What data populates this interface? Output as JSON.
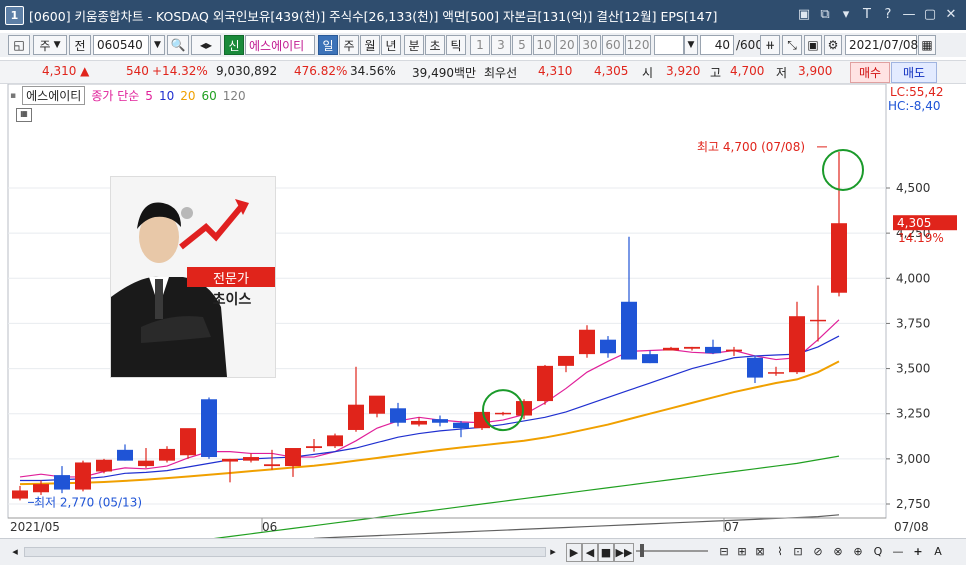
{
  "title": {
    "num": "1",
    "text": "[0600] 키움종합차트 - KOSDAQ 외국인보유[439(천)] 주식수[26,133(천)] 액면[500] 자본금[131(억)] 결산[12월] EPS[147]",
    "icons": [
      "▣",
      "⧉",
      "▾",
      "T",
      "?",
      "—",
      "▢",
      "✕"
    ]
  },
  "toolbar": {
    "type_label": "주",
    "prev_label": "전",
    "code": "060540",
    "badge_new": "신",
    "stock_name": "에스에이티",
    "periods": [
      "일",
      "주",
      "월",
      "년",
      "분",
      "초",
      "틱"
    ],
    "selected_period": "일",
    "intervals": [
      "1",
      "3",
      "5",
      "10",
      "20",
      "30",
      "60",
      "120"
    ],
    "count": "40",
    "count_total": "/600",
    "date": "2021/07/08"
  },
  "quote": {
    "price": "4,310 ▲",
    "change": "540",
    "change_pct": "+14.32%",
    "volume": "9,030,892",
    "vol_ratio": "476.82%",
    "turnover": "34.56%",
    "amount": "39,490백만",
    "best_label": "최우선",
    "ask": "4,310",
    "bid": "4,305",
    "open_label": "시",
    "open": "3,920",
    "high_label": "고",
    "high": "4,700",
    "low_label": "저",
    "low": "3,900",
    "buy_label": "매수",
    "sell_label": "매도"
  },
  "legend": {
    "stock": "에스에이티",
    "ma_label": "종가 단순",
    "ma": [
      "5",
      "10",
      "20",
      "60",
      "120"
    ],
    "ma_colors": [
      "#e0209a",
      "#2030d0",
      "#f0a000",
      "#20a020",
      "#606060"
    ]
  },
  "promo": {
    "badge": "전문가",
    "name": "초이스"
  },
  "annotations": {
    "high": "최고 4,700 (07/08)",
    "low": "최저 2,770 (05/13)",
    "lc": "LC:55,42",
    "hc": "HC:-8,40",
    "last_price": "4,305",
    "last_pct": "14.19%"
  },
  "colors": {
    "up": "#e0241b",
    "down": "#1f54d6"
  },
  "chart_data": {
    "type": "candlestick",
    "ylim": [
      2600,
      4780
    ],
    "yticks": [
      2750,
      3000,
      3250,
      3500,
      3750,
      4000,
      4250,
      4500
    ],
    "ytick_labels": [
      "2,750",
      "3,000",
      "3,250",
      "3,500",
      "3,750",
      "4,000",
      "4,250",
      "4,500"
    ],
    "x_labels": [
      {
        "index": 0,
        "text": "2021/05"
      },
      {
        "index": 12,
        "text": "06"
      },
      {
        "index": 34,
        "text": "07"
      },
      {
        "index": 39,
        "text": "07/08"
      }
    ],
    "candles": [
      {
        "o": 2780,
        "h": 2850,
        "l": 2770,
        "c": 2825
      },
      {
        "o": 2815,
        "h": 2880,
        "l": 2800,
        "c": 2860
      },
      {
        "o": 2910,
        "h": 2960,
        "l": 2810,
        "c": 2830
      },
      {
        "o": 2830,
        "h": 2990,
        "l": 2820,
        "c": 2980
      },
      {
        "o": 2930,
        "h": 3000,
        "l": 2920,
        "c": 2995
      },
      {
        "o": 3050,
        "h": 3080,
        "l": 2990,
        "c": 2990
      },
      {
        "o": 2960,
        "h": 3060,
        "l": 2950,
        "c": 2990
      },
      {
        "o": 2990,
        "h": 3070,
        "l": 2980,
        "c": 3055
      },
      {
        "o": 3020,
        "h": 3150,
        "l": 3000,
        "c": 3170
      },
      {
        "o": 3330,
        "h": 3340,
        "l": 3000,
        "c": 3010
      },
      {
        "o": 2985,
        "h": 3000,
        "l": 2870,
        "c": 3000
      },
      {
        "o": 2990,
        "h": 3030,
        "l": 2980,
        "c": 3010
      },
      {
        "o": 2960,
        "h": 3050,
        "l": 2940,
        "c": 2970
      },
      {
        "o": 2960,
        "h": 3000,
        "l": 2900,
        "c": 3060
      },
      {
        "o": 3060,
        "h": 3110,
        "l": 3040,
        "c": 3070
      },
      {
        "o": 3070,
        "h": 3140,
        "l": 3060,
        "c": 3130
      },
      {
        "o": 3160,
        "h": 3510,
        "l": 3150,
        "c": 3300
      },
      {
        "o": 3250,
        "h": 3340,
        "l": 3230,
        "c": 3350
      },
      {
        "o": 3280,
        "h": 3310,
        "l": 3180,
        "c": 3200
      },
      {
        "o": 3190,
        "h": 3230,
        "l": 3180,
        "c": 3210
      },
      {
        "o": 3220,
        "h": 3240,
        "l": 3180,
        "c": 3200
      },
      {
        "o": 3200,
        "h": 3210,
        "l": 3120,
        "c": 3170
      },
      {
        "o": 3170,
        "h": 3260,
        "l": 3160,
        "c": 3260
      },
      {
        "o": 3250,
        "h": 3260,
        "l": 3240,
        "c": 3255
      },
      {
        "o": 3240,
        "h": 3330,
        "l": 3220,
        "c": 3320
      },
      {
        "o": 3320,
        "h": 3520,
        "l": 3300,
        "c": 3515
      },
      {
        "o": 3515,
        "h": 3540,
        "l": 3480,
        "c": 3570
      },
      {
        "o": 3580,
        "h": 3740,
        "l": 3560,
        "c": 3715
      },
      {
        "o": 3660,
        "h": 3680,
        "l": 3560,
        "c": 3585
      },
      {
        "o": 3870,
        "h": 4230,
        "l": 3560,
        "c": 3550
      },
      {
        "o": 3580,
        "h": 3600,
        "l": 3530,
        "c": 3530
      },
      {
        "o": 3600,
        "h": 3620,
        "l": 3600,
        "c": 3615
      },
      {
        "o": 3610,
        "h": 3620,
        "l": 3600,
        "c": 3620
      },
      {
        "o": 3620,
        "h": 3660,
        "l": 3580,
        "c": 3585
      },
      {
        "o": 3595,
        "h": 3620,
        "l": 3570,
        "c": 3605
      },
      {
        "o": 3560,
        "h": 3570,
        "l": 3420,
        "c": 3450
      },
      {
        "o": 3480,
        "h": 3510,
        "l": 3460,
        "c": 3480
      },
      {
        "o": 3480,
        "h": 3870,
        "l": 3470,
        "c": 3790
      },
      {
        "o": 3770,
        "h": 3960,
        "l": 3650,
        "c": 3770
      },
      {
        "o": 3920,
        "h": 4700,
        "l": 3900,
        "c": 4305
      }
    ],
    "series": [
      {
        "name": "5",
        "color": "#e0209a",
        "values": [
          2900,
          2915,
          2900,
          2900,
          2930,
          2950,
          2945,
          2960,
          3005,
          3040,
          3040,
          3030,
          3030,
          3010,
          3010,
          3040,
          3100,
          3170,
          3210,
          3230,
          3215,
          3205,
          3200,
          3215,
          3245,
          3310,
          3390,
          3480,
          3540,
          3595,
          3600,
          3605,
          3590,
          3585,
          3600,
          3570,
          3550,
          3560,
          3660,
          3770
        ]
      },
      {
        "name": "10",
        "color": "#2030d0",
        "values": [
          2880,
          2880,
          2885,
          2890,
          2900,
          2920,
          2925,
          2935,
          2955,
          2975,
          2995,
          3000,
          3005,
          3010,
          3025,
          3040,
          3060,
          3090,
          3120,
          3140,
          3155,
          3165,
          3175,
          3190,
          3210,
          3230,
          3260,
          3300,
          3340,
          3380,
          3420,
          3460,
          3500,
          3530,
          3560,
          3570,
          3575,
          3580,
          3620,
          3680
        ]
      },
      {
        "name": "20",
        "color": "#f0a000",
        "values": [
          2860,
          2862,
          2865,
          2868,
          2872,
          2878,
          2885,
          2893,
          2902,
          2912,
          2922,
          2932,
          2942,
          2952,
          2962,
          2975,
          2990,
          3005,
          3020,
          3035,
          3050,
          3063,
          3075,
          3088,
          3100,
          3118,
          3140,
          3165,
          3190,
          3220,
          3250,
          3280,
          3310,
          3340,
          3370,
          3395,
          3420,
          3440,
          3480,
          3540
        ]
      },
      {
        "name": "60",
        "color": "#20a020",
        "values": [
          null,
          null,
          null,
          null,
          null,
          null,
          2510,
          2525,
          2540,
          2555,
          2570,
          2585,
          2600,
          2615,
          2630,
          2645,
          2660,
          2675,
          2690,
          2705,
          2720,
          2735,
          2750,
          2765,
          2780,
          2795,
          2810,
          2825,
          2840,
          2855,
          2870,
          2885,
          2900,
          2915,
          2930,
          2945,
          2960,
          2975,
          2995,
          3015
        ]
      },
      {
        "name": "120",
        "color": "#606060",
        "values": [
          null,
          null,
          null,
          null,
          null,
          null,
          null,
          null,
          null,
          null,
          null,
          null,
          null,
          null,
          2560,
          2565,
          2570,
          2575,
          2580,
          2585,
          2590,
          2595,
          2600,
          2605,
          2610,
          2615,
          2620,
          2625,
          2630,
          2635,
          2640,
          2645,
          2650,
          2655,
          2660,
          2665,
          2670,
          2675,
          2680,
          2690
        ]
      }
    ]
  },
  "bottom": {
    "nav": [
      "▶",
      "◀",
      "■",
      "▶▶"
    ],
    "tools": [
      "⊟",
      "⊞",
      "⊠",
      "⌇",
      "⊡",
      "⊘",
      "⊗",
      "⊕",
      "Q",
      "—",
      "+",
      "A"
    ]
  }
}
